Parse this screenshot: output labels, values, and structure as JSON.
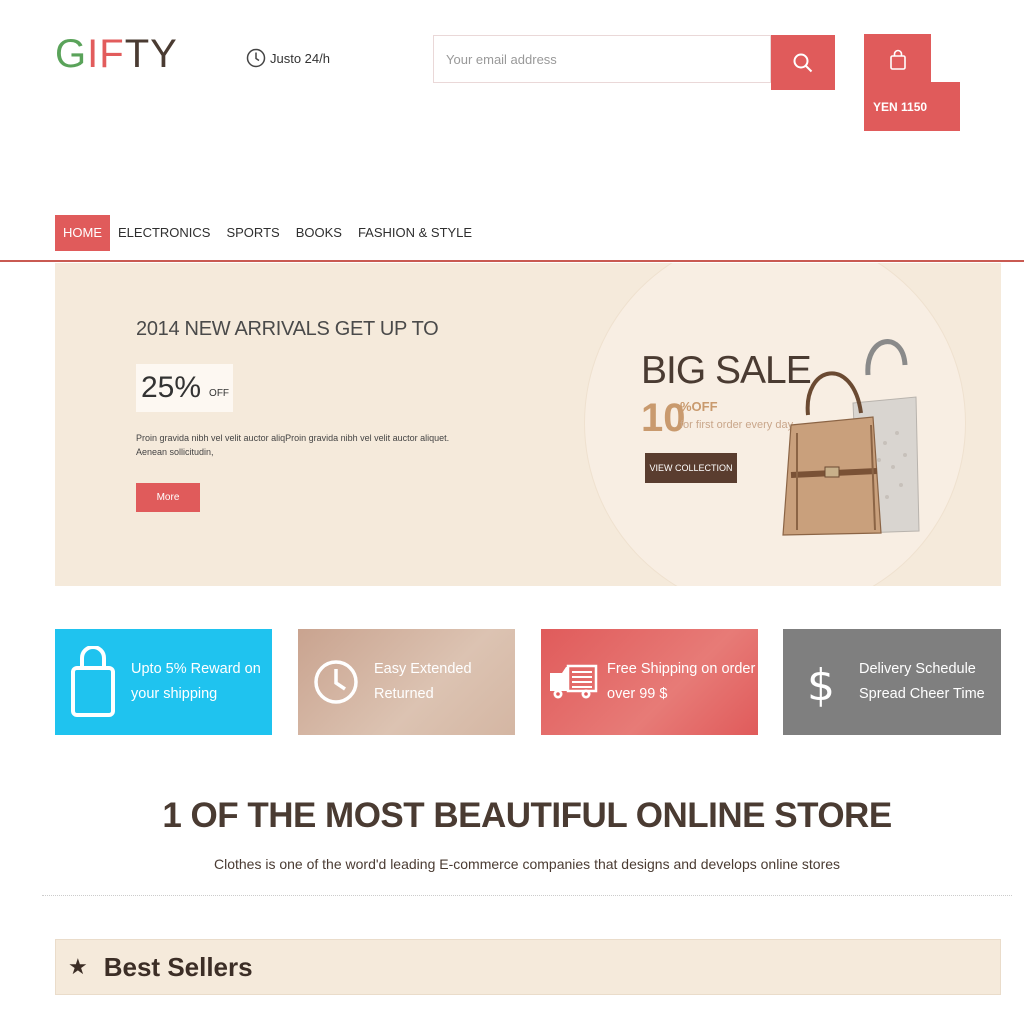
{
  "header": {
    "logo": {
      "g": "G",
      "i": "I",
      "f": "F",
      "rest": "TY"
    },
    "hours": "Justo 24/h",
    "search": {
      "placeholder": "Your email address"
    },
    "cart": {
      "total": "YEN 1150"
    }
  },
  "nav": {
    "items": [
      {
        "label": "HOME",
        "active": true
      },
      {
        "label": "ELECTRONICS"
      },
      {
        "label": "SPORTS"
      },
      {
        "label": "BOOKS"
      },
      {
        "label": "FASHION & STYLE"
      }
    ]
  },
  "hero": {
    "title": "2014 NEW ARRIVALS GET UP TO",
    "discount": "25%",
    "discount_suffix": "OFF",
    "text": "Proin gravida nibh vel velit auctor aliqProin gravida nibh vel velit auctor aliquet. Aenean sollicitudin,",
    "more_label": "More",
    "big_sale": "BIG SALE",
    "sale_number": "10",
    "sale_pct_off": "%OFF",
    "sale_note": "for first order every day",
    "view_collection": "VIEW COLLECTION"
  },
  "features": [
    {
      "line1": "Upto 5% Reward on",
      "line2": "your shipping",
      "icon": "shopping-bag-icon",
      "color": "#1fc3ef"
    },
    {
      "line1": "Easy Extended",
      "line2": "Returned",
      "icon": "clock-icon",
      "color": "#c9a38f"
    },
    {
      "line1": "Free Shipping on order",
      "line2": "over 99 $",
      "icon": "truck-icon",
      "color": "#e05b5b"
    },
    {
      "line1": "Delivery Schedule",
      "line2": "Spread Cheer Time",
      "icon": "dollar-icon",
      "color": "#7f7f7f"
    }
  ],
  "tagline": {
    "headline": "1 OF THE MOST BEAUTIFUL ONLINE STORE",
    "subline": "Clothes is one of the word'd leading E-commerce companies that designs and develops online stores"
  },
  "best_sellers": {
    "label": "Best Sellers",
    "icon": "star-icon"
  },
  "colors": {
    "accent": "#e05b5b",
    "brown": "#4a3b32",
    "cream": "#f5eadb"
  }
}
